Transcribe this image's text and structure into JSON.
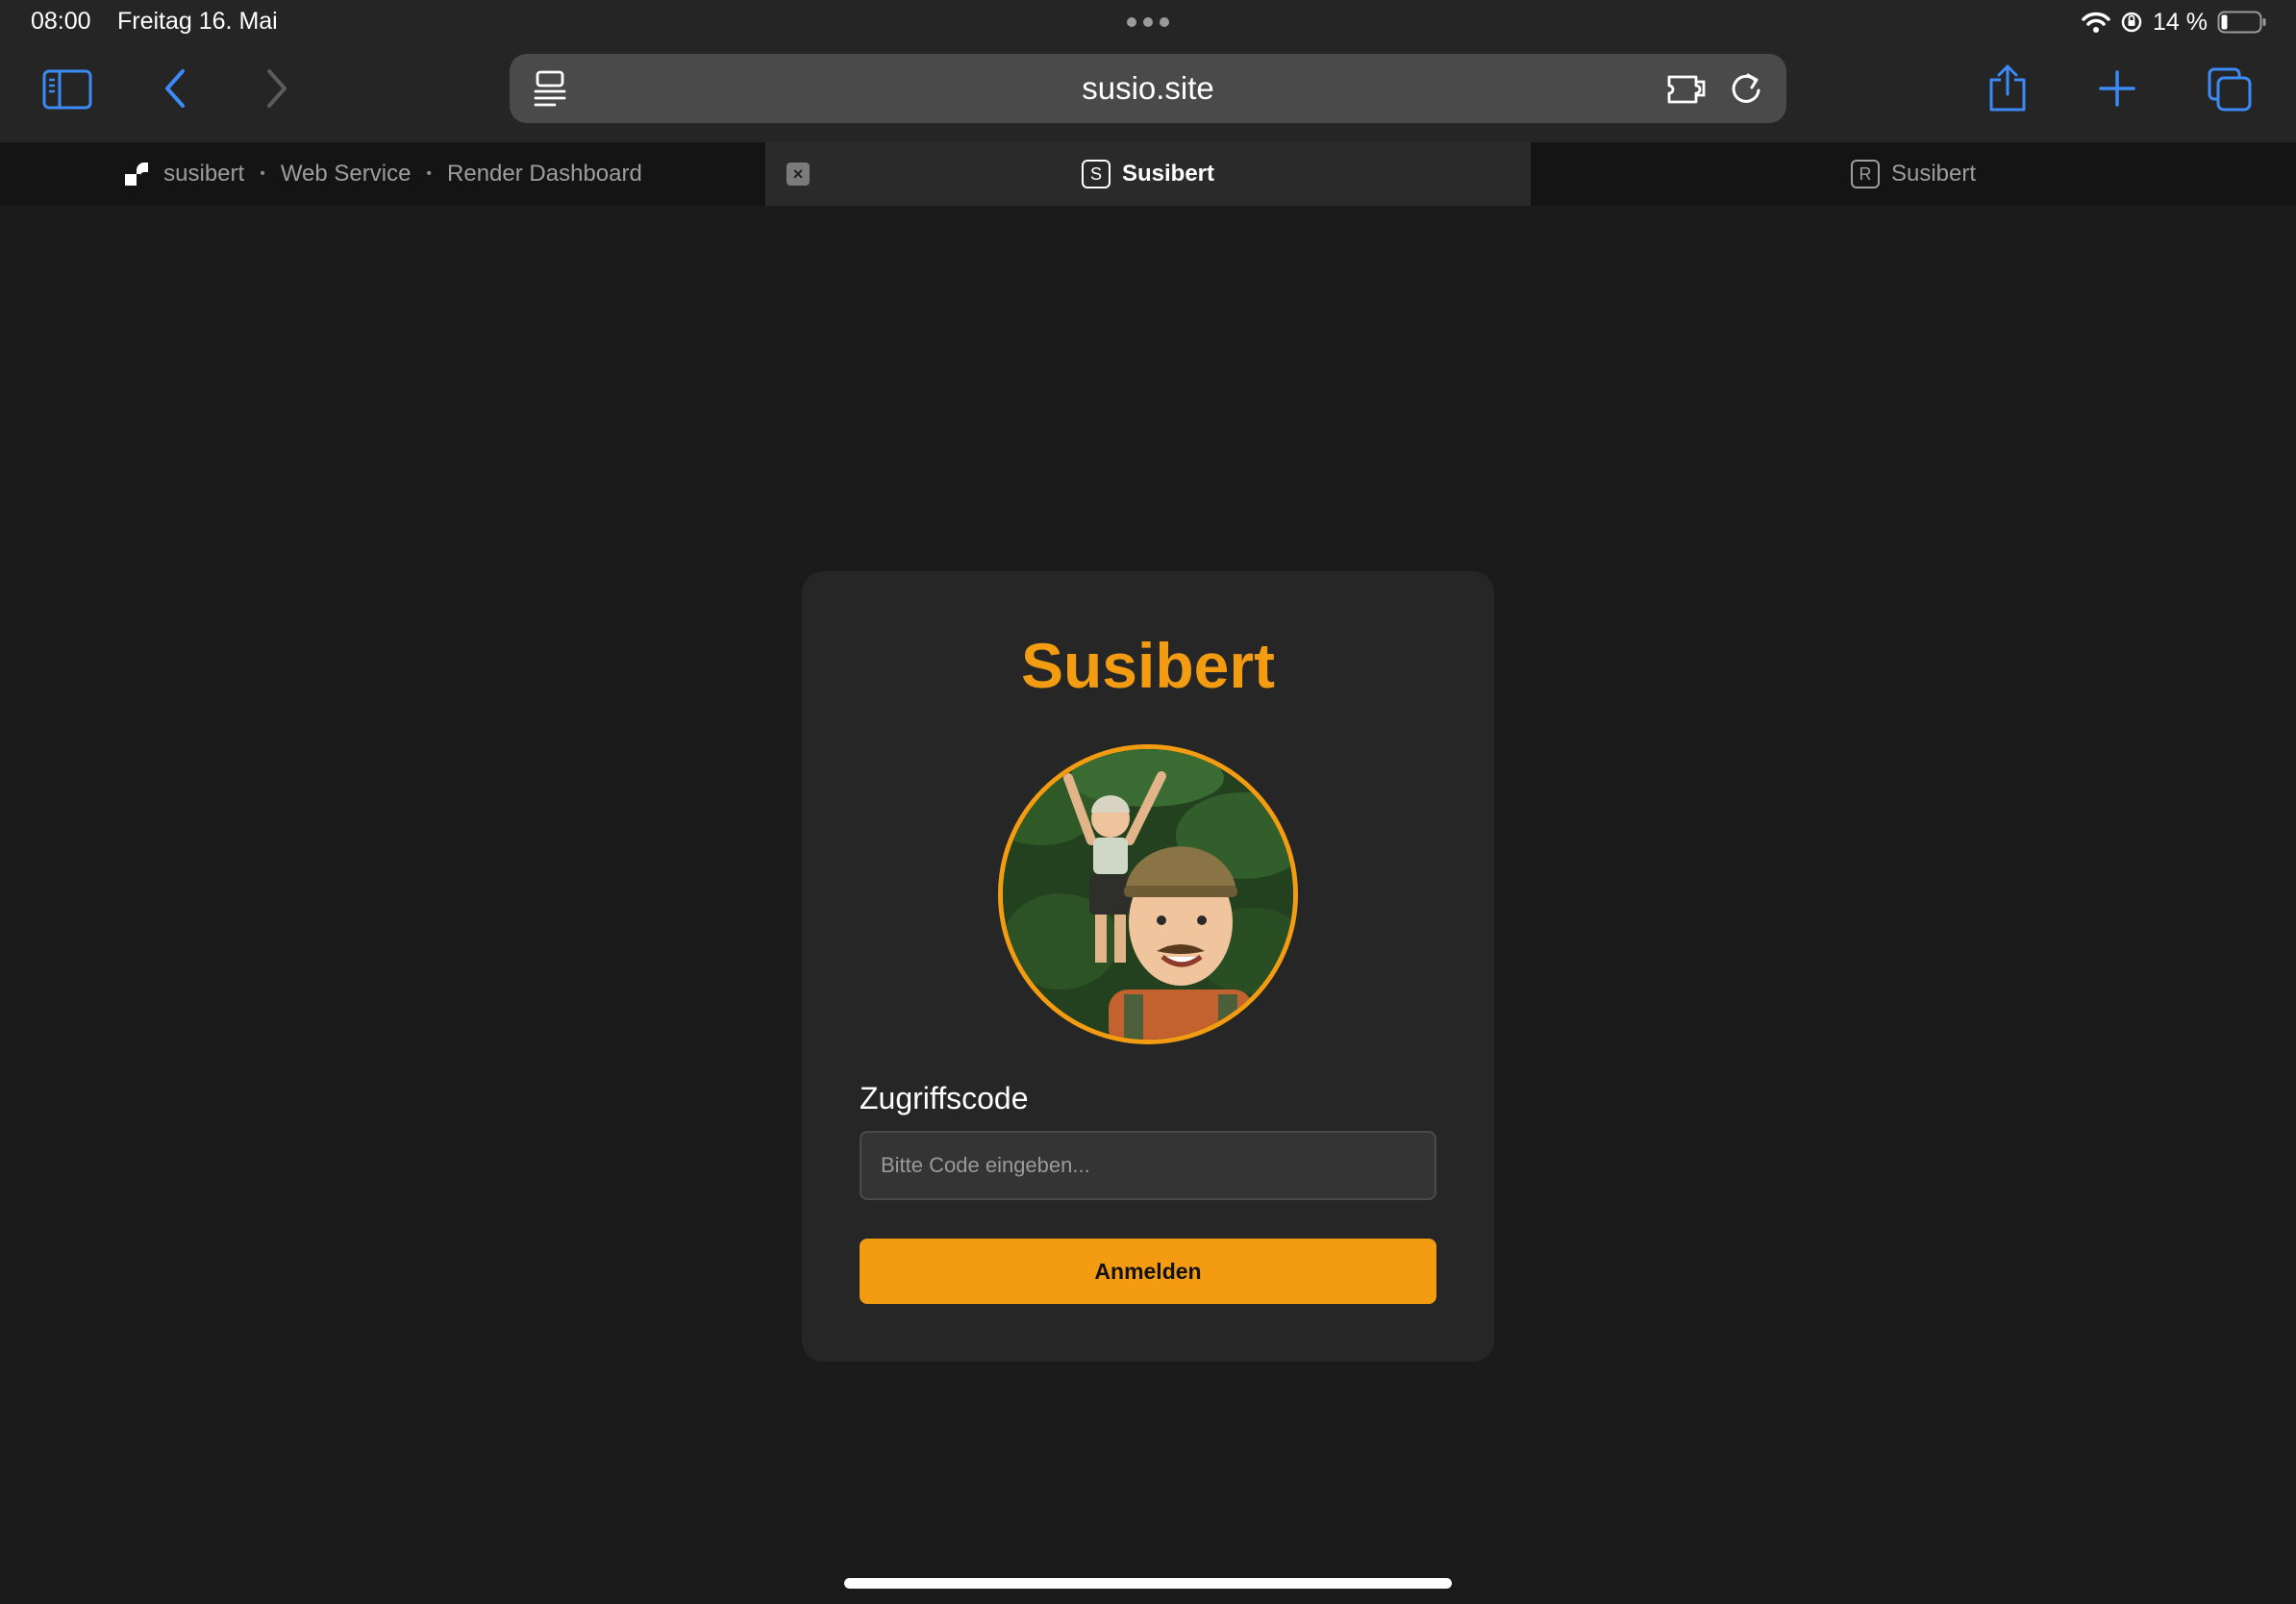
{
  "status_bar": {
    "time": "08:00",
    "date": "Freitag 16. Mai",
    "battery": "14 %"
  },
  "toolbar": {
    "url": "susio.site",
    "icons": [
      "sidebar-icon",
      "back-icon",
      "forward-icon",
      "reader-icon",
      "extension-icon",
      "reload-icon",
      "share-icon",
      "plus-icon",
      "tabs-icon"
    ]
  },
  "tabs": [
    {
      "parts": [
        "susibert",
        "Web Service",
        "Render Dashboard"
      ],
      "separator": "•",
      "active": false
    },
    {
      "favicon_letter": "S",
      "label": "Susibert",
      "active": true,
      "close": "×"
    },
    {
      "favicon_letter": "R",
      "label": "Susibert",
      "active": false
    }
  ],
  "login": {
    "title": "Susibert",
    "avatar": "illustrated-selfie-avatar",
    "field_label": "Zugriffscode",
    "placeholder": "Bitte Code eingeben...",
    "value": "",
    "button_label": "Anmelden"
  },
  "colors": {
    "accent": "#f39c12",
    "page_bg": "#1b1b1b",
    "card_bg": "#262626",
    "chrome_bg": "#252525",
    "link_blue": "#3b8af5"
  }
}
